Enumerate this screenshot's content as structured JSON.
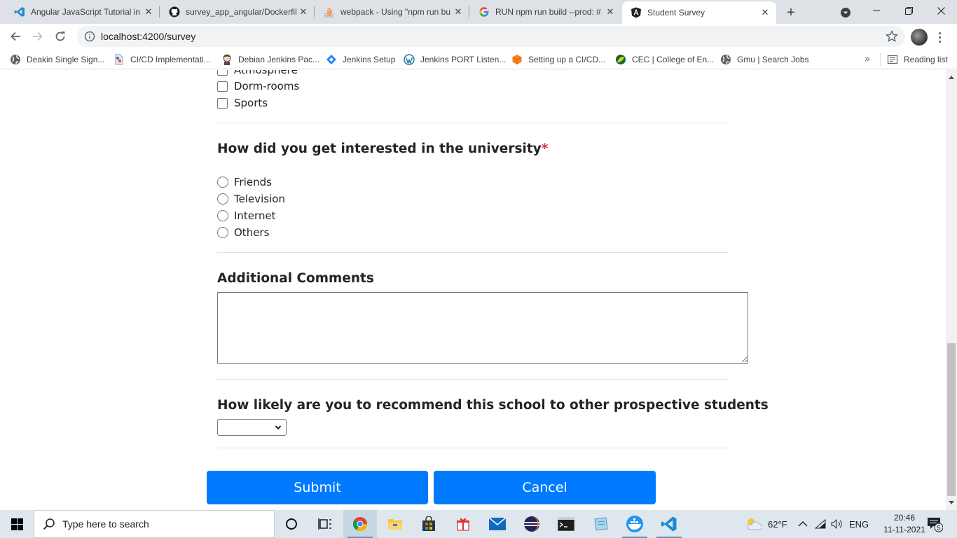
{
  "browser": {
    "tabs": [
      {
        "title": "Angular JavaScript Tutorial in",
        "icon": "vscode-icon"
      },
      {
        "title": "survey_app_angular/Dockerfil",
        "icon": "github-icon"
      },
      {
        "title": "webpack - Using \"npm run bu",
        "icon": "stackoverflow-icon"
      },
      {
        "title": "RUN npm run build --prod: #",
        "icon": "google-icon"
      },
      {
        "title": "Student Survey",
        "icon": "angular-icon"
      }
    ],
    "url": "localhost:4200/survey",
    "bookmarks": [
      {
        "label": "Deakin Single Sign...",
        "icon": "globe-icon"
      },
      {
        "label": "CI/CD Implementati...",
        "icon": "bookmark-icon"
      },
      {
        "label": "Debian Jenkins Pac...",
        "icon": "jenkins-icon"
      },
      {
        "label": "Jenkins Setup",
        "icon": "diamond-icon"
      },
      {
        "label": "Jenkins PORT Listen...",
        "icon": "wordpress-icon"
      },
      {
        "label": "Setting up a CI/CD...",
        "icon": "cube-icon"
      },
      {
        "label": "CEC | College of En...",
        "icon": "leaf-icon"
      },
      {
        "label": "Gmu | Search Jobs",
        "icon": "globe-icon"
      }
    ],
    "more_bookmarks": "»",
    "reading_list": "Reading list"
  },
  "survey": {
    "partial_option": "Atmosphere",
    "checkbox_options": [
      "Dorm-rooms",
      "Sports"
    ],
    "interest_question": "How did you get interested in the university",
    "required_mark": "*",
    "interest_options": [
      "Friends",
      "Television",
      "Internet",
      "Others"
    ],
    "comments_label": "Additional Comments",
    "comments_value": "",
    "recommend_question": "How likely are you to recommend this school to other prospective students",
    "recommend_selected": "",
    "submit_label": "Submit",
    "cancel_label": "Cancel",
    "button_color": "#007bff",
    "required_color": "#dc3545"
  },
  "taskbar": {
    "search_placeholder": "Type here to search",
    "weather": "62°F",
    "language": "ENG",
    "time": "20:46",
    "date": "11-11-2021",
    "notification_count": "5"
  }
}
